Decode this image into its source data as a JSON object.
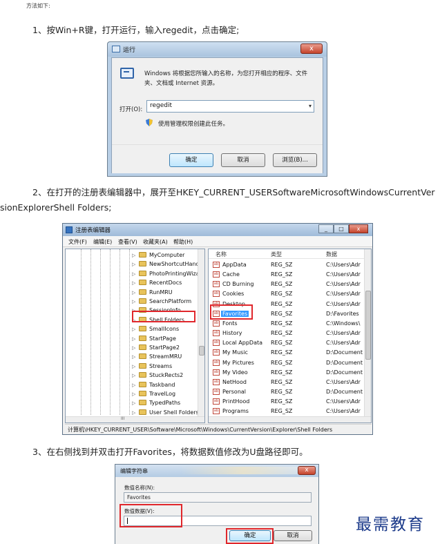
{
  "header_note": "方法如下:",
  "steps": {
    "step1": "1、按Win+R键，打开运行，输入regedit，点击确定;",
    "step2_line1": "2、在打开的注册表编辑器中，展开至HKEY_CURRENT_USERSoftwareMicrosoftWindowsCurrentVer",
    "step2_line2": "sionExplorerShell  Folders;",
    "step3": "3、在右侧找到并双击打开Favorites，将数据数值修改为U盘路径即可。"
  },
  "run_dialog": {
    "title": "运行",
    "close_glyph": "x",
    "description": "Windows 将根据您所输入的名称，为您打开相应的程序、文件夹、文档或 Internet 资源。",
    "open_label": "打开(O):",
    "open_value": "regedit",
    "combo_arrow": "▾",
    "admin_note": "使用管理权限创建此任务。",
    "ok_label": "确定",
    "cancel_label": "取消",
    "browse_label": "浏览(B)..."
  },
  "regedit": {
    "title": "注册表编辑器",
    "min_glyph": "_",
    "max_glyph": "□",
    "close_glyph": "x",
    "menu": [
      "文件(F)",
      "编辑(E)",
      "查看(V)",
      "收藏夹(A)",
      "帮助(H)"
    ],
    "tree_items": [
      "MyComputer",
      "NewShortcutHandl",
      "PhotoPrintingWiza",
      "RecentDocs",
      "RunMRU",
      "SearchPlatform",
      "SessionInfo",
      "Shell Folders",
      "SmallIcons",
      "StartPage",
      "StartPage2",
      "StreamMRU",
      "Streams",
      "StuckRects2",
      "Taskband",
      "TravelLog",
      "TypedPaths",
      "User Shell Folders"
    ],
    "tree_arrow": "▷",
    "hscroll_glyph": "III",
    "value_icon": "ab",
    "columns": [
      "名称",
      "类型",
      "数据"
    ],
    "values": [
      {
        "name": "AppData",
        "type": "REG_SZ",
        "data": "C:\\Users\\Adr"
      },
      {
        "name": "Cache",
        "type": "REG_SZ",
        "data": "C:\\Users\\Adr"
      },
      {
        "name": "CD Burning",
        "type": "REG_SZ",
        "data": "C:\\Users\\Adr"
      },
      {
        "name": "Cookies",
        "type": "REG_SZ",
        "data": "C:\\Users\\Adr"
      },
      {
        "name": "Desktop",
        "type": "REG_SZ",
        "data": "C:\\Users\\Adr"
      },
      {
        "name": "Favorites",
        "type": "REG_SZ",
        "data": "D:\\Favorites"
      },
      {
        "name": "Fonts",
        "type": "REG_SZ",
        "data": "C:\\Windows\\"
      },
      {
        "name": "History",
        "type": "REG_SZ",
        "data": "C:\\Users\\Adr"
      },
      {
        "name": "Local AppData",
        "type": "REG_SZ",
        "data": "C:\\Users\\Adr"
      },
      {
        "name": "My Music",
        "type": "REG_SZ",
        "data": "D:\\Document"
      },
      {
        "name": "My Pictures",
        "type": "REG_SZ",
        "data": "D:\\Document"
      },
      {
        "name": "My Video",
        "type": "REG_SZ",
        "data": "D:\\Document"
      },
      {
        "name": "NetHood",
        "type": "REG_SZ",
        "data": "C:\\Users\\Adr"
      },
      {
        "name": "Personal",
        "type": "REG_SZ",
        "data": "D:\\Document"
      },
      {
        "name": "PrintHood",
        "type": "REG_SZ",
        "data": "C:\\Users\\Adr"
      },
      {
        "name": "Programs",
        "type": "REG_SZ",
        "data": "C:\\Users\\Adr"
      }
    ],
    "status_path": "计算机\\HKEY_CURRENT_USER\\Software\\Microsoft\\Windows\\CurrentVersion\\Explorer\\Shell Folders"
  },
  "edit_dialog": {
    "title": "编辑字符串",
    "close_glyph": "x",
    "name_label": "数值名称(N):",
    "name_value": "Favorites",
    "data_label": "数值数据(V):",
    "data_value": "",
    "ok_label": "确定",
    "cancel_label": "取消"
  },
  "watermark": "最需教育",
  "colors": {
    "highlight_box": "#e0262b",
    "selection": "#3399ff",
    "watermark": "#1b3a8a"
  }
}
